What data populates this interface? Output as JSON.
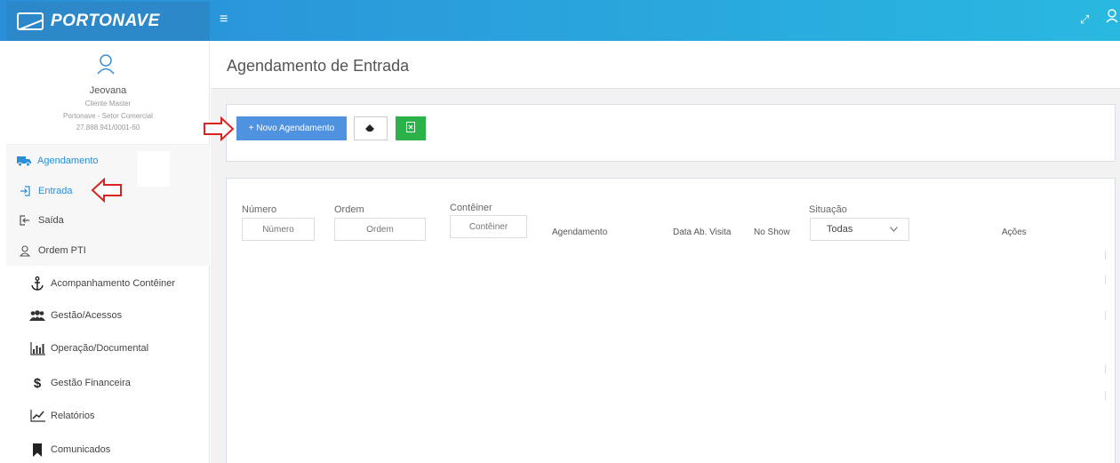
{
  "header": {
    "brand": "PORTONAVE",
    "menu_icon": "hamburger-icon",
    "expand_icon": "expand-icon",
    "user_icon": "user-icon"
  },
  "profile": {
    "name": "Jeovana",
    "role": "Cliente Master",
    "company": "Portonave - Setor Comercial",
    "cnpj": "27.888.941/0001-60"
  },
  "sidebar": {
    "items": [
      {
        "label": "Agendamento",
        "icon": "truck-icon",
        "active": true
      },
      {
        "label": "Entrada",
        "icon": "sign-in-icon",
        "active": true
      },
      {
        "label": "Saída",
        "icon": "sign-out-icon"
      },
      {
        "label": "Ordem PTI",
        "icon": "user-icon"
      },
      {
        "label": "Acompanhamento Contêiner",
        "icon": "anchor-icon"
      },
      {
        "label": "Gestão/Acessos",
        "icon": "users-icon"
      },
      {
        "label": "Operação/Documental",
        "icon": "bar-chart-icon"
      },
      {
        "label": "Gestão Financeira",
        "icon": "dollar-icon"
      },
      {
        "label": "Relatórios",
        "icon": "line-chart-icon"
      },
      {
        "label": "Comunicados",
        "icon": "bookmark-icon"
      }
    ]
  },
  "page": {
    "title": "Agendamento de Entrada"
  },
  "toolbar": {
    "new_label": "+ Novo Agendamento",
    "clear_icon": "eraser-icon",
    "export_icon": "excel-icon"
  },
  "filters": {
    "numero": {
      "label": "Número",
      "placeholder": "Número"
    },
    "ordem": {
      "label": "Ordem",
      "placeholder": "Ordem"
    },
    "conteiner": {
      "label": "Contêiner",
      "placeholder": "Contêiner"
    },
    "situacao": {
      "label": "Situação",
      "value": "Todas"
    }
  },
  "table": {
    "columns": [
      "Agendamento",
      "Data Ab. Visita",
      "No Show",
      "Ações"
    ]
  },
  "colors": {
    "topbar": "#2a8ed8",
    "primary_button": "#4f92e0",
    "excel_button": "#2bb34a",
    "active_link": "#2a8ed8",
    "annotation_arrow": "#d9231f"
  }
}
